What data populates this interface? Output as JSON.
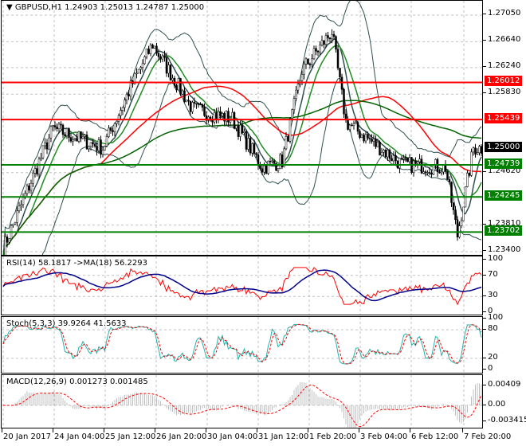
{
  "header": {
    "title": "GBPUSD,H1  1.24903 1.25013 1.24787 1.25000",
    "menu_icon": "triangle-down-icon"
  },
  "price_axis": {
    "ticks": [
      "1.27050",
      "1.26640",
      "1.26240",
      "1.25830",
      "1.24620",
      "1.23810",
      "1.23400"
    ],
    "levels": [
      {
        "label": "1.26012",
        "price": 1.26012,
        "color": "#ff0000"
      },
      {
        "label": "1.25439",
        "price": 1.25439,
        "color": "#ff0000"
      },
      {
        "label": "1.25000",
        "price": 1.25,
        "color": "#000000"
      },
      {
        "label": "1.24739",
        "price": 1.24739,
        "color": "#008000"
      },
      {
        "label": "1.24245",
        "price": 1.24245,
        "color": "#008000"
      },
      {
        "label": "1.23702",
        "price": 1.23702,
        "color": "#008000"
      }
    ]
  },
  "price_path": [
    [
      0,
      1.2345
    ],
    [
      25,
      1.253
    ],
    [
      50,
      1.25
    ],
    [
      65,
      1.26
    ],
    [
      75,
      1.266
    ],
    [
      95,
      1.256
    ],
    [
      115,
      1.2545
    ],
    [
      130,
      1.247
    ],
    [
      140,
      1.248
    ],
    [
      150,
      1.262
    ],
    [
      165,
      1.268
    ],
    [
      172,
      1.254
    ],
    [
      185,
      1.251
    ],
    [
      200,
      1.2475
    ],
    [
      222,
      1.247
    ],
    [
      228,
      1.2365
    ],
    [
      236,
      1.25
    ],
    [
      241,
      1.25
    ]
  ],
  "rsi": {
    "title": "RSI(14) 58.1817  ->MA(18) 56.2293",
    "ticks": [
      "100",
      "70",
      "30",
      "0"
    ]
  },
  "stoch": {
    "title": "Stoch(5,3,3) 39.9264 41.5633",
    "ticks": [
      "100",
      "80",
      "20",
      "0"
    ]
  },
  "macd": {
    "title": "MACD(12,26,9) 0.001273 0.001485",
    "ticks": [
      "0.00409",
      "0.00",
      "-0.003415"
    ]
  },
  "time_axis": [
    "20 Jan 2017",
    "24 Jan 04:00",
    "25 Jan 12:00",
    "26 Jan 20:00",
    "30 Jan 04:00",
    "31 Jan 12:00",
    "1 Feb 20:00",
    "3 Feb 04:00",
    "6 Feb 12:00",
    "7 Feb 20:00"
  ],
  "colors": {
    "candle": "#000000",
    "bands": "#2f4f4f",
    "ma_red": "#ff0000",
    "ma_green": "#006400",
    "rsi": "#ff0000",
    "rsi_ma": "#00008b",
    "stoch_main": "#20b2aa",
    "stoch_signal": "#ff0000",
    "macd_hist": "#c0c0c0",
    "macd_signal": "#ff0000"
  }
}
